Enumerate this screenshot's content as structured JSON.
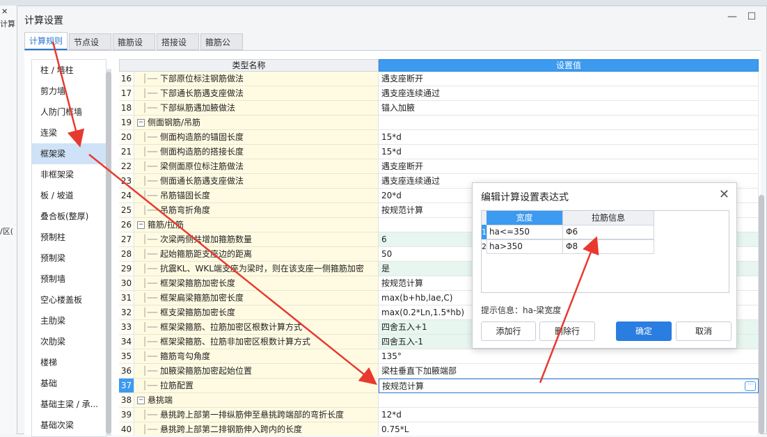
{
  "background": {
    "title_fragment": "计算",
    "side_label": "/区("
  },
  "dialog": {
    "title": "计算设置",
    "tabs": [
      "计算规则",
      "节点设置",
      "箍筋设置",
      "搭接设置",
      "箍筋公式"
    ],
    "active_tab": 0
  },
  "categories": [
    "柱 / 墙柱",
    "剪力墙",
    "人防门框墙",
    "连梁",
    "框架梁",
    "非框架梁",
    "板 / 坡道",
    "叠合板(整厚)",
    "预制柱",
    "预制梁",
    "预制墙",
    "空心楼盖板",
    "主肋梁",
    "次肋梁",
    "楼梯",
    "基础",
    "基础主梁 / 承...",
    "基础次梁"
  ],
  "selected_category": "框架梁",
  "table": {
    "col_name": "类型名称",
    "col_value": "设置值",
    "rows": [
      {
        "num": "16",
        "name": "下部原位标注钢筋做法",
        "value": "遇支座断开",
        "group": false,
        "green": false
      },
      {
        "num": "17",
        "name": "下部通长筋遇支座做法",
        "value": "遇支座连续通过",
        "group": false,
        "green": false
      },
      {
        "num": "18",
        "name": "下部纵筋遇加腋做法",
        "value": "锚入加腋",
        "group": false,
        "green": false
      },
      {
        "num": "19",
        "name": "侧面钢筋/吊筋",
        "value": "",
        "group": true,
        "green": false
      },
      {
        "num": "20",
        "name": "侧面构造筋的锚固长度",
        "value": "15*d",
        "group": false,
        "green": false
      },
      {
        "num": "21",
        "name": "侧面构造筋的搭接长度",
        "value": "15*d",
        "group": false,
        "green": false
      },
      {
        "num": "22",
        "name": "梁侧面原位标注筋做法",
        "value": "遇支座断开",
        "group": false,
        "green": false
      },
      {
        "num": "23",
        "name": "侧面通长筋遇支座做法",
        "value": "遇支座连续通过",
        "group": false,
        "green": false
      },
      {
        "num": "24",
        "name": "吊筋锚固长度",
        "value": "20*d",
        "group": false,
        "green": false
      },
      {
        "num": "25",
        "name": "吊筋弯折角度",
        "value": "按规范计算",
        "group": false,
        "green": false
      },
      {
        "num": "26",
        "name": "箍筋/拉筋",
        "value": "",
        "group": true,
        "green": false
      },
      {
        "num": "27",
        "name": "次梁两侧共增加箍筋数量",
        "value": "6",
        "group": false,
        "green": true
      },
      {
        "num": "28",
        "name": "起始箍筋距支座边的距离",
        "value": "50",
        "group": false,
        "green": false
      },
      {
        "num": "29",
        "name": "抗震KL、WKL端支座为梁时，则在该支座一侧箍筋加密",
        "value": "是",
        "group": false,
        "green": true
      },
      {
        "num": "30",
        "name": "框架梁箍筋加密长度",
        "value": "按规范计算",
        "group": false,
        "green": false
      },
      {
        "num": "31",
        "name": "框架扁梁箍筋加密长度",
        "value": "max(b+hb,lae,C)",
        "group": false,
        "green": false
      },
      {
        "num": "32",
        "name": "框支梁箍筋加密长度",
        "value": "max(0.2*Ln,1.5*hb)",
        "group": false,
        "green": false
      },
      {
        "num": "33",
        "name": "框架梁箍筋、拉筋加密区根数计算方式",
        "value": "四舍五入+1",
        "group": false,
        "green": true
      },
      {
        "num": "34",
        "name": "框架梁箍筋、拉筋非加密区根数计算方式",
        "value": "四舍五入-1",
        "group": false,
        "green": true
      },
      {
        "num": "35",
        "name": "箍筋弯勾角度",
        "value": "135°",
        "group": false,
        "green": false
      },
      {
        "num": "36",
        "name": "加腋梁箍筋加密起始位置",
        "value": "梁柱垂直下加腋端部",
        "group": false,
        "green": false
      },
      {
        "num": "37",
        "name": "拉筋配置",
        "value": "按规范计算",
        "group": false,
        "green": false
      },
      {
        "num": "38",
        "name": "悬挑端",
        "value": "",
        "group": true,
        "green": false
      },
      {
        "num": "39",
        "name": "悬挑跨上部第一排纵筋伸至悬挑跨端部的弯折长度",
        "value": "12*d",
        "group": false,
        "green": false
      },
      {
        "num": "40",
        "name": "悬挑跨上部第二排钢筋伸入跨内的长度",
        "value": "0.75*L",
        "group": false,
        "green": false
      }
    ],
    "selected_row": "37",
    "ellipsis": "···"
  },
  "expression_dialog": {
    "title": "编辑计算设置表达式",
    "col_width": "宽度",
    "col_tie": "拉筋信息",
    "rows": [
      {
        "num": "1",
        "width": "ha<=350",
        "tie": "Φ6"
      },
      {
        "num": "2",
        "width": "ha>350",
        "tie": "Φ8"
      }
    ],
    "hint": "提示信息：ha-梁宽度",
    "buttons": {
      "add": "添加行",
      "delete": "删除行",
      "ok": "确定",
      "cancel": "取消"
    }
  },
  "colors": {
    "accent": "#3c9af0",
    "primary_button": "#2a7de1",
    "arrow": "#e8392f",
    "green_row": "#e7f6ef",
    "name_cell": "#fffbe3"
  }
}
